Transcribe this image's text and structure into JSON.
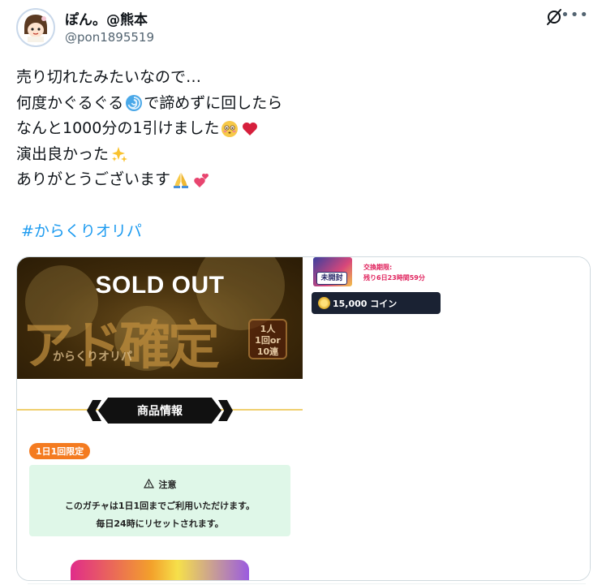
{
  "user": {
    "display_name": "ぽん。@熊本",
    "handle": "@pon1895519"
  },
  "post": {
    "lines": [
      {
        "text": "売り切れたみたいなので…",
        "emojis": []
      },
      {
        "text": "何度かぐるぐる",
        "emojis": [
          "cyclone"
        ],
        "tail": "で諦めずに回したら"
      },
      {
        "text": "なんと1000分の1引けました",
        "emojis": [
          "flushed-face",
          "red-heart"
        ],
        "tail": ""
      },
      {
        "text": "演出良かった",
        "emojis": [
          "sparkles"
        ],
        "tail": ""
      },
      {
        "text": "ありがとうございます",
        "emojis": [
          "folded-hands",
          "two-hearts"
        ],
        "tail": ""
      }
    ],
    "hashtag": "#からくりオリパ"
  },
  "media": {
    "left": {
      "sold_out": "SOLD OUT",
      "banner_big": "アド確定",
      "banner_sub": "からくりオリパ",
      "badge_lines": [
        "1人",
        "1回or",
        "10連"
      ],
      "section_title": "商品情報",
      "limit_pill": "1日1回限定",
      "notice_title": "注意",
      "notice_line1": "このガチャは1日1回までご利用いただけます。",
      "notice_line2": "毎日24時にリセットされます。"
    },
    "right": {
      "unopened_label": "未開封",
      "exchange_label": "交換期限:",
      "exchange_remaining": "残り6日23時間59分",
      "coin_button": "15,000 コイン"
    }
  },
  "colors": {
    "hashtag": "#1d9bf0",
    "handle": "#536471",
    "notice_bg": "#dff7e8",
    "limit_pill": "#f47b20",
    "coin_button_bg": "#1a2233"
  },
  "icons": {
    "grok": "grok-icon",
    "more": "more-icon",
    "warning": "warning-icon",
    "coin": "coin-icon"
  }
}
